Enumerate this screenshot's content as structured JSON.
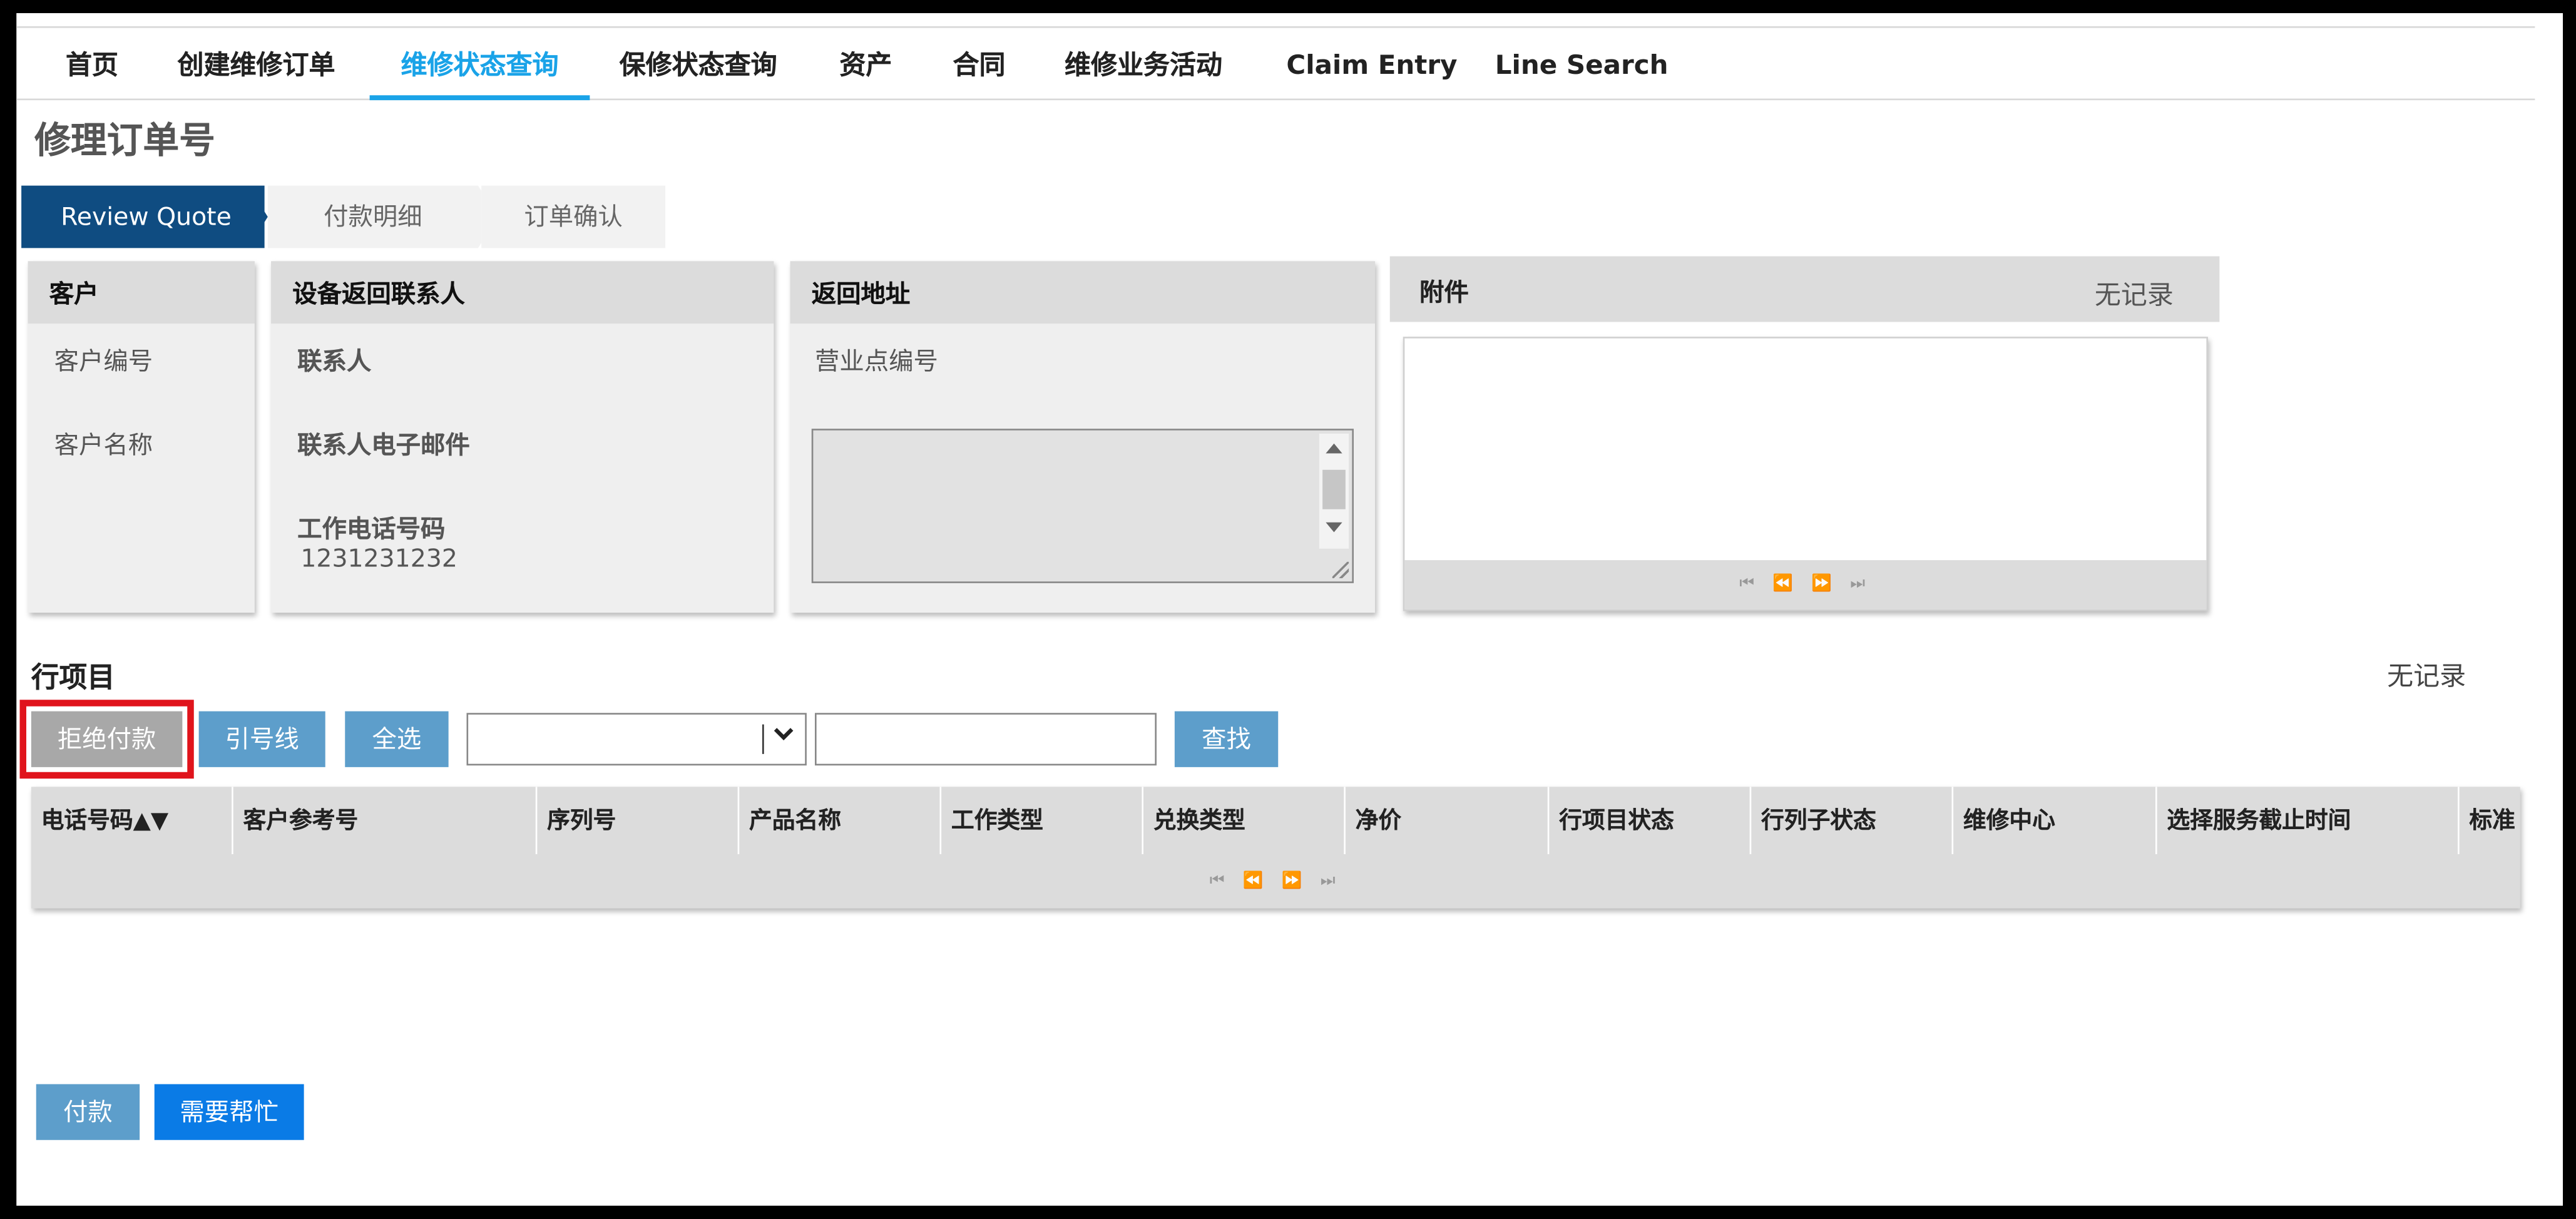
{
  "nav": [
    "首页",
    "创建维修订单",
    "维修状态查询",
    "保修状态查询",
    "资产",
    "合同",
    "维修业务活动",
    "Claim Entry",
    "Line Search"
  ],
  "page_title": "修理订单号",
  "steps": [
    "Review Quote",
    "付款明细",
    "订单确认"
  ],
  "customer": {
    "title": "客户",
    "number_label": "客户编号",
    "name_label": "客户名称"
  },
  "contact": {
    "title": "设备返回联系人",
    "contact_label": "联系人",
    "email_label": "联系人电子邮件",
    "phone_label": "工作电话号码",
    "phone_value": "1231231232"
  },
  "address": {
    "title": "返回地址",
    "branch_label": "营业点编号"
  },
  "attachments": {
    "title": "附件",
    "no_record": "无记录",
    "pager": "⏮ ⏪ ⏩ ⏭"
  },
  "line_items": {
    "title": "行项目",
    "no_record": "无记录",
    "reject_label": "拒绝付款",
    "ref_label": "引号线",
    "select_all_label": "全选",
    "search_label": "查找",
    "search_value": "",
    "columns": [
      "电话号码▲▼",
      "客户参考号",
      "序列号",
      "产品名称",
      "工作类型",
      "兑换类型",
      "净价",
      "行项目状态",
      "行列子状态",
      "维修中心",
      "选择服务截止时间",
      "标准"
    ],
    "pager": "⏮ ⏪ ⏩ ⏭"
  },
  "footer": {
    "pay_label": "付款",
    "help_label": "需要帮忙"
  },
  "colors": {
    "accent": "#1aa3e8",
    "step_active": "#0f4c81",
    "button": "#5d9ecb",
    "primary": "#0a7be6",
    "highlight": "#e0141c"
  }
}
